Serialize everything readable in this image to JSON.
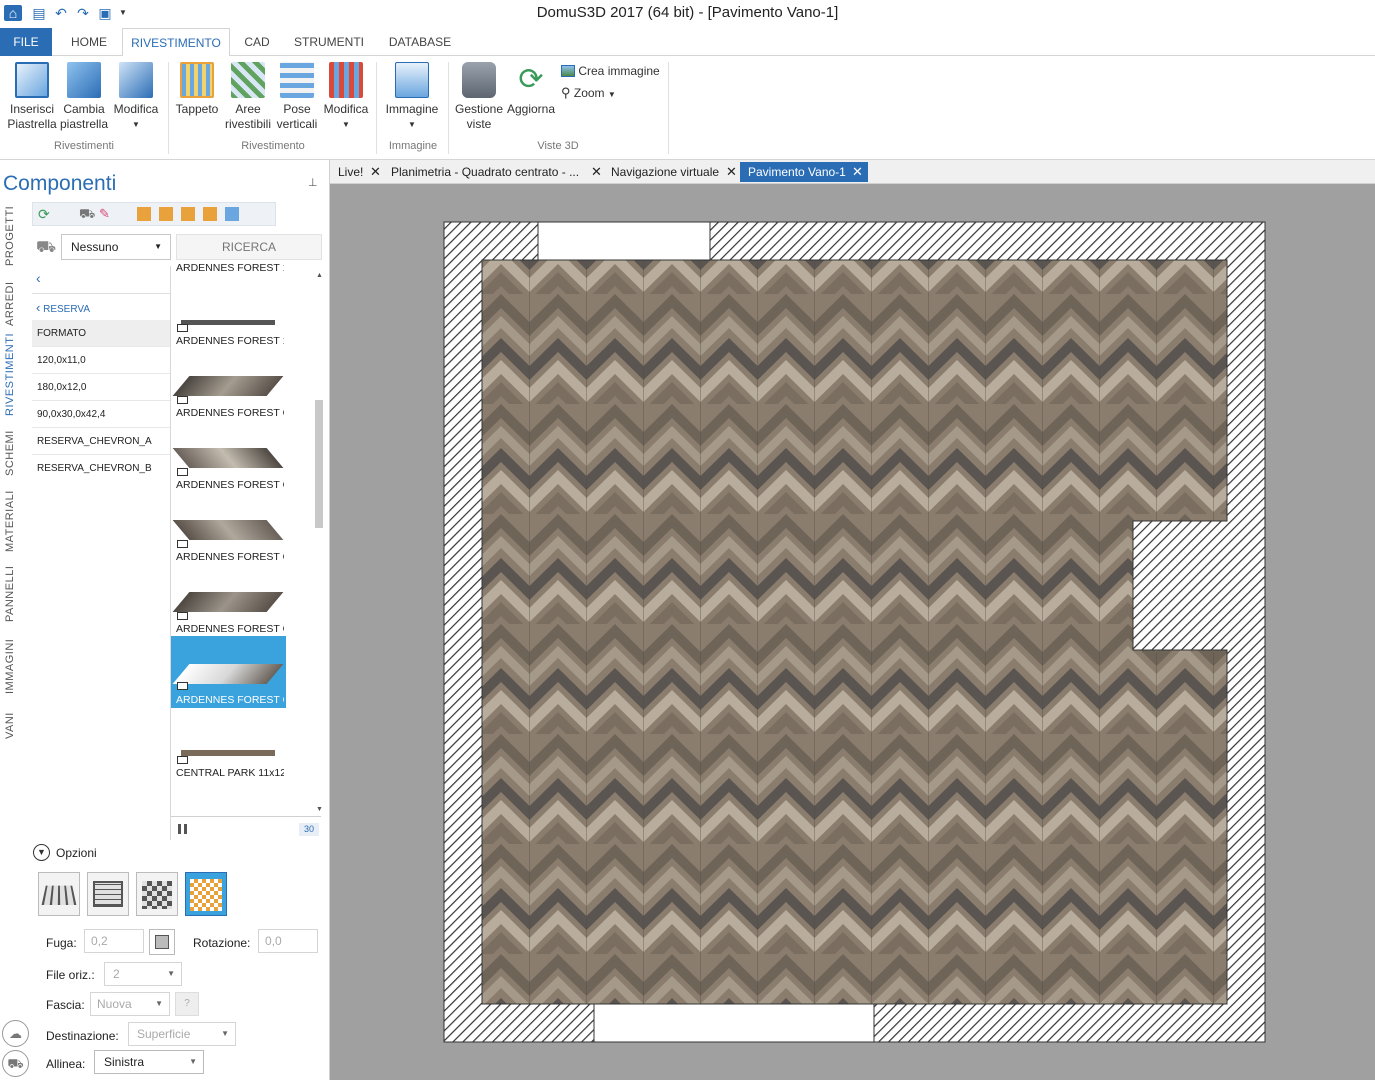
{
  "window": {
    "title": "DomuS3D 2017 (64 bit) - [Pavimento Vano-1]"
  },
  "ribbon_tabs": [
    {
      "label": "FILE"
    },
    {
      "label": "HOME"
    },
    {
      "label": "RIVESTIMENTO"
    },
    {
      "label": "CAD"
    },
    {
      "label": "STRUMENTI"
    },
    {
      "label": "DATABASE"
    }
  ],
  "ribbon": {
    "inserisci": [
      "Inserisci",
      "Piastrella"
    ],
    "cambia": [
      "Cambia",
      "piastrella"
    ],
    "modifica1": "Modifica",
    "tappeto": "Tappeto",
    "aree": [
      "Aree",
      "rivestibili"
    ],
    "pose": [
      "Pose",
      "verticali"
    ],
    "modifica2": "Modifica",
    "immagine": "Immagine",
    "gestione": [
      "Gestione",
      "viste"
    ],
    "aggiorna": "Aggiorna",
    "crea_immagine": "Crea immagine",
    "zoom": "Zoom",
    "groups": {
      "rivestimenti": "Rivestimenti",
      "rivestimento": "Rivestimento",
      "immagine": "Immagine",
      "viste3d": "Viste 3D"
    }
  },
  "panel": {
    "title": "Componenti",
    "vertical_tabs": [
      "PROGETTI",
      "ARREDI",
      "RIVESTIMENTI",
      "SCHEMI",
      "MATERIALI",
      "PANNELLI",
      "IMMAGINI",
      "VANI"
    ],
    "cart_select": "Nessuno",
    "search_placeholder": "RICERCA",
    "breadcrumb": "RESERVA",
    "list_header": "FORMATO",
    "list_items": [
      "120,0x11,0",
      "180,0x12,0",
      "90,0x30,0x42,4",
      "RESERVA_CHEVRON_A",
      "RESERVA_CHEVRON_B"
    ],
    "thumbs": [
      "ARDENNES FOREST 1.",
      "ARDENNES FOREST 1.",
      "ARDENNES FOREST C",
      "ARDENNES FOREST C",
      "ARDENNES FOREST C",
      "ARDENNES FOREST C",
      "ARDENNES FOREST C",
      "CENTRAL PARK 11x12"
    ],
    "count_badge": "30",
    "options_label": "Opzioni",
    "form": {
      "fuga_label": "Fuga:",
      "fuga_value": "0,2",
      "rotazione_label": "Rotazione:",
      "rotazione_value": "0,0",
      "file_label": "File oriz.:",
      "file_value": "2",
      "fascia_label": "Fascia:",
      "fascia_value": "Nuova",
      "fascia_help": "?",
      "dest_label": "Destinazione:",
      "dest_value": "Superficie",
      "allinea_label": "Allinea:",
      "allinea_value": "Sinistra"
    }
  },
  "doc_tabs": [
    {
      "label": "Live!"
    },
    {
      "label": "Planimetria - Quadrato centrato - ..."
    },
    {
      "label": "Navigazione virtuale"
    },
    {
      "label": "Pavimento Vano-1"
    }
  ],
  "colors": {
    "accent": "#2b6db5",
    "selected": "#3aa3dd",
    "viewport_bg": "#a0a0a0"
  }
}
